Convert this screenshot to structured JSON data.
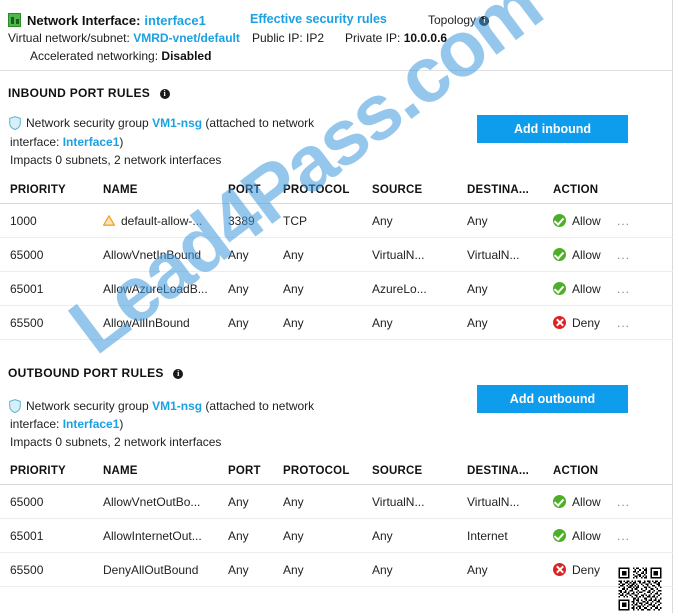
{
  "header": {
    "nic_icon": "network-interface-icon",
    "nic_label": "Network Interface:",
    "nic_name": "interface1",
    "effective_security_rules": "Effective security rules",
    "topology": "Topology",
    "info_glyph": "i",
    "vnet_label": "Virtual network/subnet:",
    "vnet_value": "VMRD-vnet/default",
    "public_ip_label": "Public IP:",
    "public_ip_value": "IP2",
    "private_ip_label": "Private IP:",
    "private_ip_value": "10.0.0.6",
    "accel_label": "Accelerated networking:",
    "accel_value": "Disabled"
  },
  "columns": [
    "PRIORITY",
    "NAME",
    "PORT",
    "PROTOCOL",
    "SOURCE",
    "DESTINA...",
    "ACTION"
  ],
  "inbound": {
    "section_title": "INBOUND PORT RULES",
    "nsg_prefix": "Network security group",
    "nsg_name": "VM1-nsg",
    "nsg_mid": "(attached to network",
    "nsg_iface_label": "interface:",
    "nsg_iface_name": "Interface1",
    "nsg_suffix": ")",
    "impacts": "Impacts 0 subnets, 2 network interfaces",
    "add_button": "Add inbound",
    "rows": [
      {
        "priority": "1000",
        "name": "default-allow-...",
        "port": "3389",
        "protocol": "TCP",
        "source": "Any",
        "destination": "Any",
        "action": "Allow",
        "action_kind": "allow",
        "warning": true,
        "more": "..."
      },
      {
        "priority": "65000",
        "name": "AllowVnetInBound",
        "port": "Any",
        "protocol": "Any",
        "source": "VirtualN...",
        "destination": "VirtualN...",
        "action": "Allow",
        "action_kind": "allow",
        "warning": false,
        "more": "..."
      },
      {
        "priority": "65001",
        "name": "AllowAzureLoadB...",
        "port": "Any",
        "protocol": "Any",
        "source": "AzureLo...",
        "destination": "Any",
        "action": "Allow",
        "action_kind": "allow",
        "warning": false,
        "more": "..."
      },
      {
        "priority": "65500",
        "name": "AllowAllInBound",
        "port": "Any",
        "protocol": "Any",
        "source": "Any",
        "destination": "Any",
        "action": "Deny",
        "action_kind": "deny",
        "warning": false,
        "more": "..."
      }
    ]
  },
  "outbound": {
    "section_title": "OUTBOUND PORT RULES",
    "nsg_prefix": "Network security group",
    "nsg_name": "VM1-nsg",
    "nsg_mid": "(attached to network",
    "nsg_iface_label": "interface:",
    "nsg_iface_name": "Interface1",
    "nsg_suffix": ")",
    "impacts": "Impacts 0 subnets, 2 network interfaces",
    "add_button": "Add outbound",
    "rows": [
      {
        "priority": "65000",
        "name": "AllowVnetOutBo...",
        "port": "Any",
        "protocol": "Any",
        "source": "VirtualN...",
        "destination": "VirtualN...",
        "action": "Allow",
        "action_kind": "allow",
        "warning": false,
        "more": "..."
      },
      {
        "priority": "65001",
        "name": "AllowInternetOut...",
        "port": "Any",
        "protocol": "Any",
        "source": "Any",
        "destination": "Internet",
        "action": "Allow",
        "action_kind": "allow",
        "warning": false,
        "more": "..."
      },
      {
        "priority": "65500",
        "name": "DenyAllOutBound",
        "port": "Any",
        "protocol": "Any",
        "source": "Any",
        "destination": "Any",
        "action": "Deny",
        "action_kind": "deny",
        "warning": false,
        "more": ""
      }
    ]
  },
  "watermark": {
    "text": "Lead4Pass.com"
  },
  "colors": {
    "link": "#1ba1e2",
    "button": "#0e9ced",
    "allow": "#4caf27",
    "deny": "#dd2222",
    "warning": "#f2a32a",
    "watermark": "#3f9ae0"
  }
}
